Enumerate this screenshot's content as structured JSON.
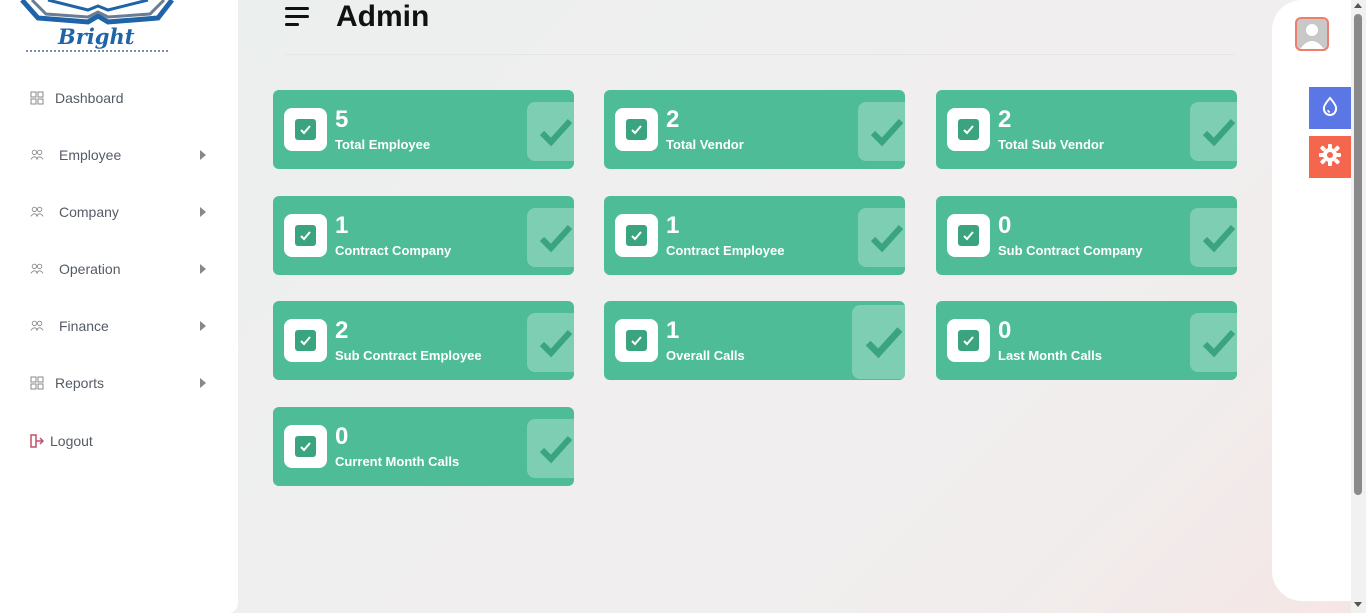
{
  "brand": {
    "logo_text": "Bright"
  },
  "sidebar": {
    "items": [
      {
        "label": "Dashboard",
        "icon": "grid-icon",
        "has_arrow": false
      },
      {
        "label": "Employee",
        "icon": "users-icon",
        "has_arrow": true
      },
      {
        "label": "Company",
        "icon": "users-icon",
        "has_arrow": true
      },
      {
        "label": "Operation",
        "icon": "users-icon",
        "has_arrow": true
      },
      {
        "label": "Finance",
        "icon": "users-icon",
        "has_arrow": true
      },
      {
        "label": "Reports",
        "icon": "grid-icon",
        "has_arrow": true
      },
      {
        "label": "Logout",
        "icon": "logout-icon",
        "has_arrow": false
      }
    ]
  },
  "header": {
    "title": "Admin",
    "menu_icon": "hamburger-icon"
  },
  "stats": [
    {
      "value": "5",
      "label": "Total Employee"
    },
    {
      "value": "2",
      "label": "Total Vendor"
    },
    {
      "value": "2",
      "label": "Total Sub Vendor"
    },
    {
      "value": "1",
      "label": "Contract Company"
    },
    {
      "value": "1",
      "label": "Contract Employee"
    },
    {
      "value": "0",
      "label": "Sub Contract Company"
    },
    {
      "value": "2",
      "label": "Sub Contract Employee"
    },
    {
      "value": "1",
      "label": "Overall Calls"
    },
    {
      "value": "0",
      "label": "Last Month Calls"
    },
    {
      "value": "0",
      "label": "Current Month Calls"
    }
  ],
  "right_panel": {
    "avatar_icon": "user-avatar-icon",
    "buttons": [
      {
        "icon": "water-drop-icon",
        "color": "#5b77e6"
      },
      {
        "icon": "gear-icon",
        "color": "#f4664e"
      }
    ]
  },
  "colors": {
    "card": "#4dbc97",
    "card_check": "#3aa47f",
    "accent_blue": "#5b77e6",
    "accent_orange": "#f4664e"
  }
}
